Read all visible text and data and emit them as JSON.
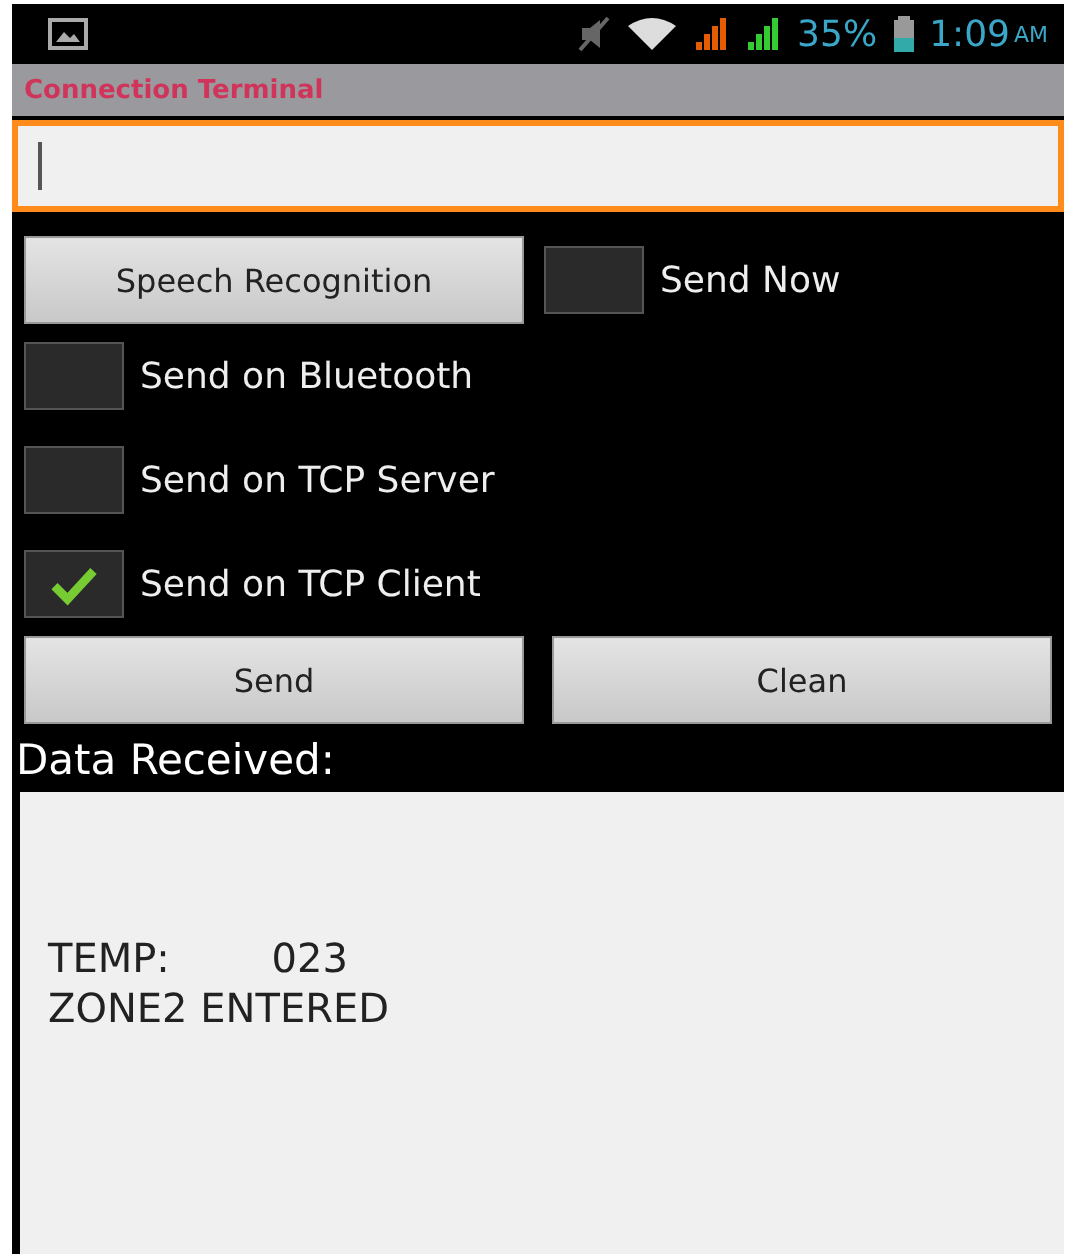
{
  "status_bar": {
    "battery": "35%",
    "time": "1:09",
    "meridiem": "AM"
  },
  "title_bar": {
    "title": "Connection Terminal"
  },
  "message_field": {
    "focused": true
  },
  "speech_button": "Speech Recognition",
  "send_now": {
    "label": "Send Now",
    "checked": false
  },
  "options": [
    {
      "label": "Send on Bluetooth",
      "checked": false
    },
    {
      "label": "Send on TCP Server",
      "checked": false
    },
    {
      "label": "Send on TCP Client",
      "checked": true
    }
  ],
  "buttons": [
    "Send",
    "Clean"
  ],
  "received": {
    "label": "Data Received:",
    "lines": [
      "TEMP:        023",
      "ZONE2 ENTERED"
    ]
  }
}
